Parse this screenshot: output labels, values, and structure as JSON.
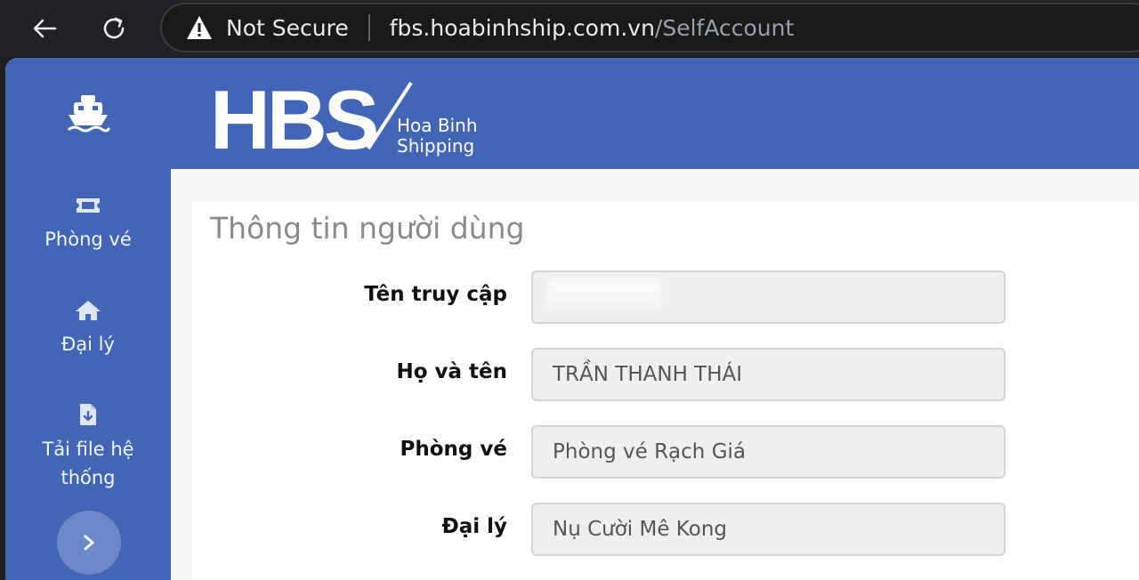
{
  "browser": {
    "security_label": "Not Secure",
    "url_host": "fbs.hoabinhship.com.vn",
    "url_path": "/SelfAccount"
  },
  "brand": {
    "letters": "HBS",
    "line1": "Hoa Binh",
    "line2": "Shipping"
  },
  "sidebar": {
    "items": [
      {
        "label": "Phòng vé",
        "icon": "ticket-icon"
      },
      {
        "label": "Đại lý",
        "icon": "home-icon"
      },
      {
        "label": "Tải file hệ thống",
        "icon": "file-download-icon"
      }
    ]
  },
  "page": {
    "title": "Thông tin người dùng"
  },
  "form": {
    "fields": [
      {
        "label": "Tên truy cập",
        "value": ""
      },
      {
        "label": "Họ và tên",
        "value": "TRẦN THANH THÁI"
      },
      {
        "label": "Phòng vé",
        "value": "Phòng vé Rạch Giá"
      },
      {
        "label": "Đại lý",
        "value": "Nụ Cười Mê Kong"
      }
    ]
  },
  "colors": {
    "brand_blue": "#4266b5",
    "field_bg": "#efefef"
  }
}
